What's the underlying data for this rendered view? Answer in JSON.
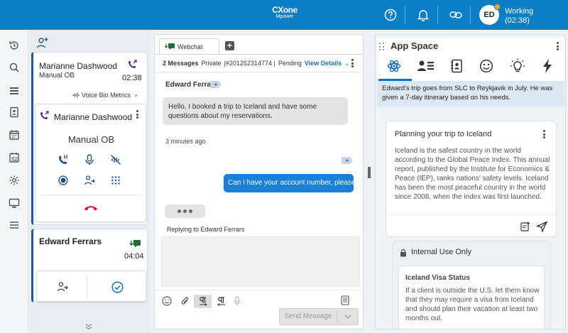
{
  "topbar": {
    "logo_line1": "CXone",
    "logo_line2": "Mpower",
    "avatar_initials": "ED",
    "status_label": "Working",
    "status_timer": "(02:38)",
    "brand_color": "#0a7fc7"
  },
  "contacts": {
    "active_call": {
      "name": "Marianne Dashwood",
      "type": "Manual OB",
      "timer": "02:38",
      "voice_bio_label": "Voice Bio Metrics"
    },
    "call_controls": {
      "name": "Marianne Dashwood",
      "mode": "Manual OB"
    },
    "chat_contact": {
      "name": "Edward Ferrars",
      "timer": "04:04"
    }
  },
  "chat": {
    "tab_label": "Webchat",
    "header_count": "2 Messages",
    "header_privacy": "Private",
    "header_id": "|#201252314774 |",
    "header_status": "Pending",
    "view_details": "View Details",
    "sender_name": "Edward Ferrars",
    "incoming_message": "Hello, I booked a trip to Iceland and have some questions about my reservations.",
    "timestamp": "3 minutes ago",
    "outgoing_message": "Can I have your account number, please?",
    "replying_to": "Replying to Edward Ferrars",
    "send_label": "Send Message"
  },
  "app_space": {
    "title": "App Space",
    "summary": "Edward's trip goes from SLC to Reykjavik in July. He was given a 7-day itinerary based on his needs.",
    "card_title": "Planning your trip to Iceland",
    "card_body": "Iceland is the safest country in the world according to the Global Peace Index. This annual report, published by the Institute for Economics & Peace (IEP), ranks nations' safety levels. Iceland has been the most peaceful country in the world since 2008, when the index was first launched.",
    "internal_label": "Internal Use Only",
    "visa_title": "Iceland Visa Status",
    "visa_body": "If a client is outside the U.S. let them know that they may require a visa from Iceland and should plan their vacation at least two months out."
  }
}
